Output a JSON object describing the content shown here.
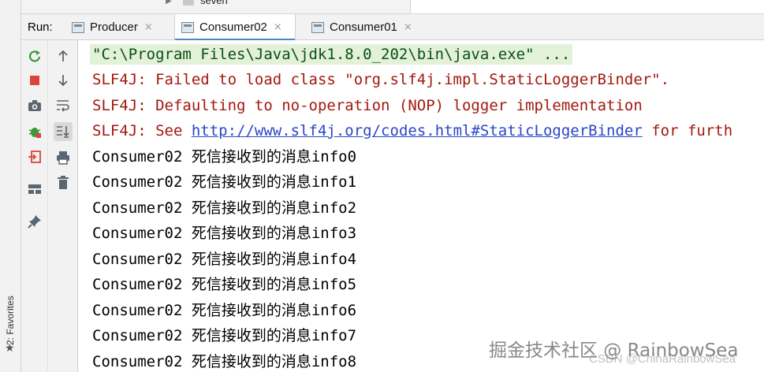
{
  "project_tree": {
    "item_label": "seven"
  },
  "favorites": {
    "label": "2: Favorites"
  },
  "run_panel": {
    "run_label": "Run:",
    "tabs": [
      {
        "label": "Producer",
        "close": "×"
      },
      {
        "label": "Consumer02",
        "close": "×",
        "active": true
      },
      {
        "label": "Consumer01",
        "close": "×"
      }
    ]
  },
  "toolbar_icons": {
    "left": [
      "rerun-icon",
      "stop-icon",
      "screenshot-icon",
      "debug-icon",
      "exit-icon",
      "layout-icon",
      "pin-icon"
    ],
    "right": [
      "scroll-up-icon",
      "scroll-down-icon",
      "soft-wrap-icon",
      "scroll-to-end-icon",
      "print-icon",
      "trash-icon"
    ]
  },
  "console": {
    "command_line": "\"C:\\Program Files\\Java\\jdk1.8.0_202\\bin\\java.exe\" ...",
    "errors": [
      "SLF4J: Failed to load class \"org.slf4j.impl.StaticLoggerBinder\".",
      "SLF4J: Defaulting to no-operation (NOP) logger implementation"
    ],
    "see_line": {
      "prefix": "SLF4J: See ",
      "link": "http://www.slf4j.org/codes.html#StaticLoggerBinder",
      "suffix": " for furth"
    },
    "messages": [
      "Consumer02 死信接收到的消息info0",
      "Consumer02 死信接收到的消息info1",
      "Consumer02 死信接收到的消息info2",
      "Consumer02 死信接收到的消息info3",
      "Consumer02 死信接收到的消息info4",
      "Consumer02 死信接收到的消息info5",
      "Consumer02 死信接收到的消息info6",
      "Consumer02 死信接收到的消息info7",
      "Consumer02 死信接收到的消息info8"
    ]
  },
  "watermark": {
    "primary": "掘金技术社区 @ RainbowSea",
    "secondary": "CSDN @ChinaRainbowSea"
  },
  "colors": {
    "command_text": "#0a4f14",
    "command_bg": "#e3f1d8",
    "error_text": "#a3180f",
    "link": "#2947c8",
    "active_tab_underline": "#4a88c7"
  }
}
